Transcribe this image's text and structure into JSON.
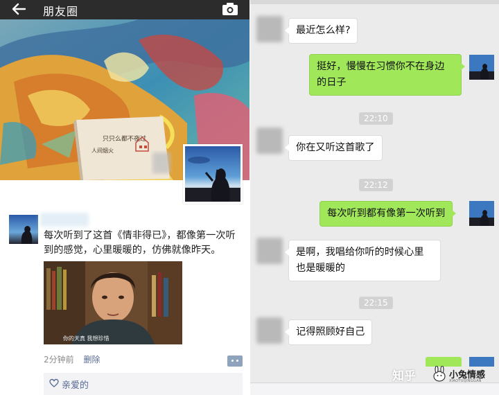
{
  "moments": {
    "title": "朋友圈",
    "cover_book_text": "只只么都不夜过 人间烟火",
    "post": {
      "text": "每次听到了这首《情非得已》，都像第一次听到的感觉，心里暖暖的，仿佛就像昨天。",
      "image_caption": "你的天真  我想珍惜",
      "time": "2分钟前",
      "delete_label": "删除",
      "like_name": "亲爱的"
    }
  },
  "chat": {
    "messages": [
      {
        "side": "in",
        "text": "最近怎么样?"
      },
      {
        "side": "out",
        "text": "挺好，慢慢在习惯你不在身边的日子"
      },
      {
        "side": "time",
        "text": "22:10"
      },
      {
        "side": "in",
        "text": "你在又听这首歌了"
      },
      {
        "side": "time",
        "text": "22:12"
      },
      {
        "side": "out",
        "text": "每次听到都有像第一次听到"
      },
      {
        "side": "in",
        "text": "是啊，我唱给你听的时候心里也是暖暖的"
      },
      {
        "side": "time",
        "text": "22:15"
      },
      {
        "side": "in",
        "text": "记得照顾好自己"
      }
    ]
  },
  "watermark": {
    "zhihu": "知乎",
    "brand": "小兔情感",
    "sub": "XIAOTUQINGGAN"
  },
  "colors": {
    "titlebar": "#2c2c2c",
    "link_blue": "#576b95",
    "bubble_green": "#a0e75a",
    "chat_bg": "#ebebeb"
  }
}
